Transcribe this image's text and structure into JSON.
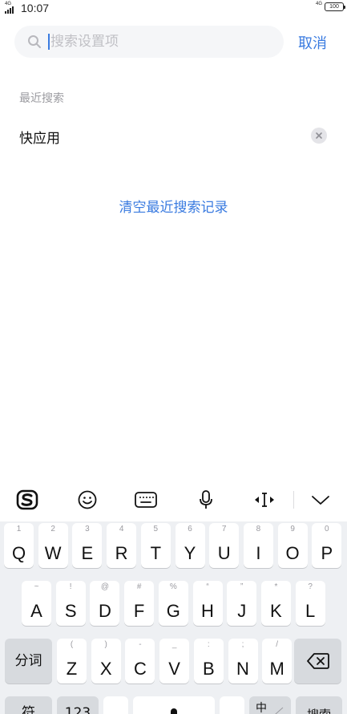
{
  "status_bar": {
    "network": "4G",
    "time": "10:07",
    "network_right": "4G",
    "battery": "100"
  },
  "search": {
    "placeholder": "搜索设置项",
    "value": "",
    "cancel_label": "取消"
  },
  "recent": {
    "header": "最近搜索",
    "items": [
      {
        "label": "快应用"
      }
    ],
    "clear_label": "清空最近搜索记录"
  },
  "keyboard_toolbar": {
    "items": [
      "sogou-logo-icon",
      "emoji-icon",
      "keyboard-icon",
      "microphone-icon",
      "cursor-move-icon",
      "collapse-keyboard-icon"
    ]
  },
  "keyboard": {
    "row1": [
      {
        "main": "Q",
        "sub": "1"
      },
      {
        "main": "W",
        "sub": "2"
      },
      {
        "main": "E",
        "sub": "3"
      },
      {
        "main": "R",
        "sub": "4"
      },
      {
        "main": "T",
        "sub": "5"
      },
      {
        "main": "Y",
        "sub": "6"
      },
      {
        "main": "U",
        "sub": "7"
      },
      {
        "main": "I",
        "sub": "8"
      },
      {
        "main": "O",
        "sub": "9"
      },
      {
        "main": "P",
        "sub": "0"
      }
    ],
    "row2": [
      {
        "main": "A",
        "sub": "~"
      },
      {
        "main": "S",
        "sub": "!"
      },
      {
        "main": "D",
        "sub": "@"
      },
      {
        "main": "F",
        "sub": "#"
      },
      {
        "main": "G",
        "sub": "%"
      },
      {
        "main": "H",
        "sub": "“"
      },
      {
        "main": "J",
        "sub": "”"
      },
      {
        "main": "K",
        "sub": "*"
      },
      {
        "main": "L",
        "sub": "?"
      }
    ],
    "row3": [
      {
        "main": "Z",
        "sub": "("
      },
      {
        "main": "X",
        "sub": ")"
      },
      {
        "main": "C",
        "sub": "-"
      },
      {
        "main": "V",
        "sub": "_"
      },
      {
        "main": "B",
        "sub": ":"
      },
      {
        "main": "N",
        "sub": ";"
      },
      {
        "main": "M",
        "sub": "/"
      }
    ],
    "fenci_label": "分词",
    "symbol_label": "符",
    "number_label": "123",
    "lang_label": "中",
    "search_label": "搜索"
  },
  "colors": {
    "accent": "#3a7be0",
    "keyboard_bg": "#eef0f3",
    "function_key_bg": "#d7dade"
  }
}
